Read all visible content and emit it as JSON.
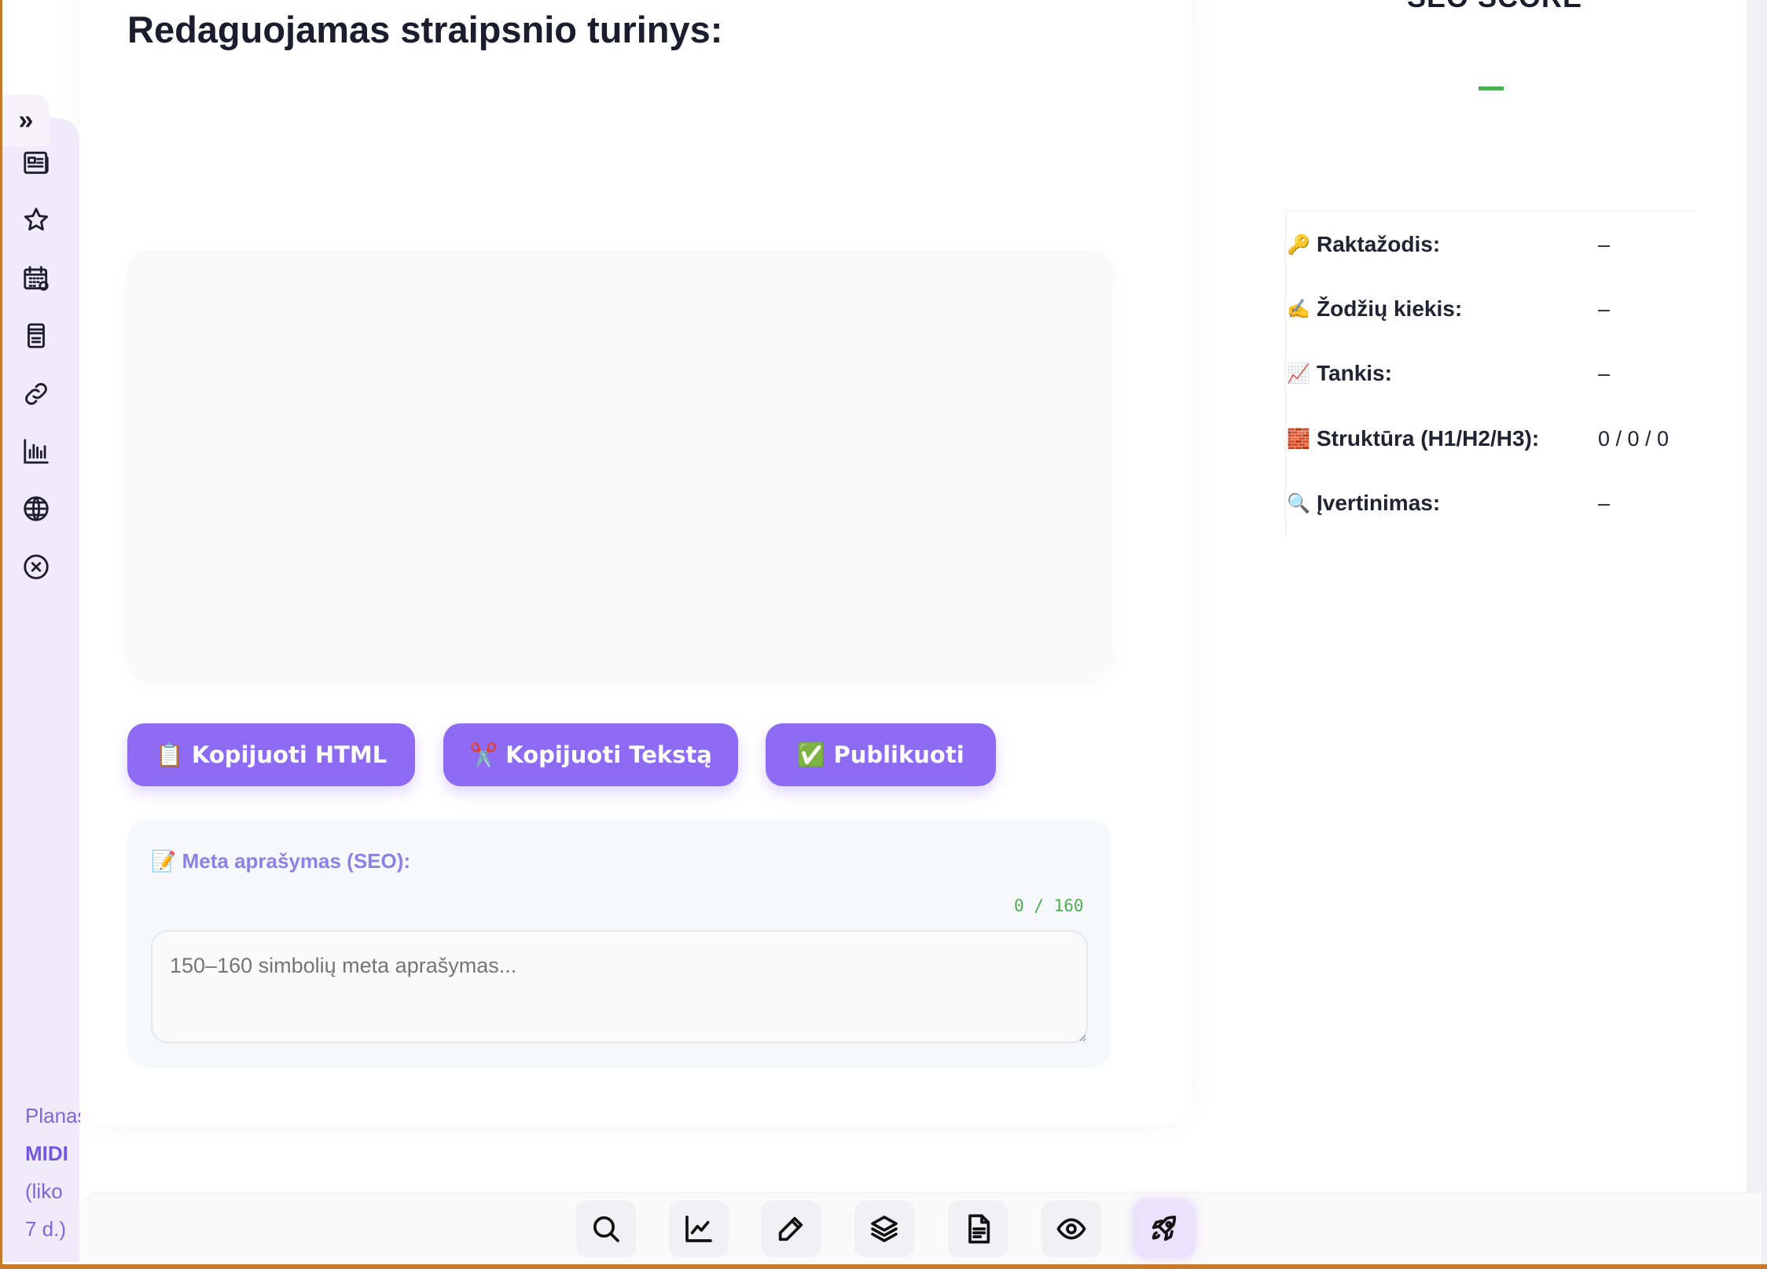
{
  "editor": {
    "title": "Redaguojamas straipsnio turinys:",
    "buttons": {
      "copy_html": "Kopijuoti HTML",
      "copy_html_emoji": "📋",
      "copy_text": "Kopijuoti Tekstą",
      "copy_text_emoji": "✂️",
      "publish": "Publikuoti",
      "publish_emoji": "✅"
    },
    "meta": {
      "label": "Meta aprašymas (SEO):",
      "label_emoji": "📝",
      "counter": "0 / 160",
      "placeholder": "150–160 simbolių meta aprašymas...",
      "value": ""
    }
  },
  "seo": {
    "title": "SEO SCORE",
    "rows": [
      {
        "emoji": "🔑",
        "label": "Raktažodis:",
        "value": "–"
      },
      {
        "emoji": "✍️",
        "label": "Žodžių kiekis:",
        "value": "–"
      },
      {
        "emoji": "📈",
        "label": "Tankis:",
        "value": "–"
      },
      {
        "emoji": "🧱",
        "label": "Struktūra (H1/H2/H3):",
        "value": "0 / 0 / 0"
      },
      {
        "emoji": "🔍",
        "label": "Įvertinimas:",
        "value": "–"
      }
    ]
  },
  "sidebar": {
    "toggle": "»",
    "icons": [
      "newspaper-icon",
      "star-icon",
      "calendar-icon",
      "archive-icon",
      "link-icon",
      "bar-chart-icon",
      "globe-icon",
      "close-circle-icon"
    ],
    "plan_line1": "Planas:",
    "plan_name": "MIDI",
    "plan_line3": "(liko",
    "plan_line4": "7 d.)"
  },
  "toolbar": {
    "icons": [
      "search-icon",
      "line-chart-icon",
      "pencil-icon",
      "layers-icon",
      "document-icon",
      "eye-icon",
      "rocket-icon"
    ],
    "active": "rocket-icon"
  },
  "colors": {
    "accent": "#8d6cf3",
    "sidebar_bg": "#efebfb",
    "success": "#4caf50",
    "frame": "#c87a2c"
  }
}
